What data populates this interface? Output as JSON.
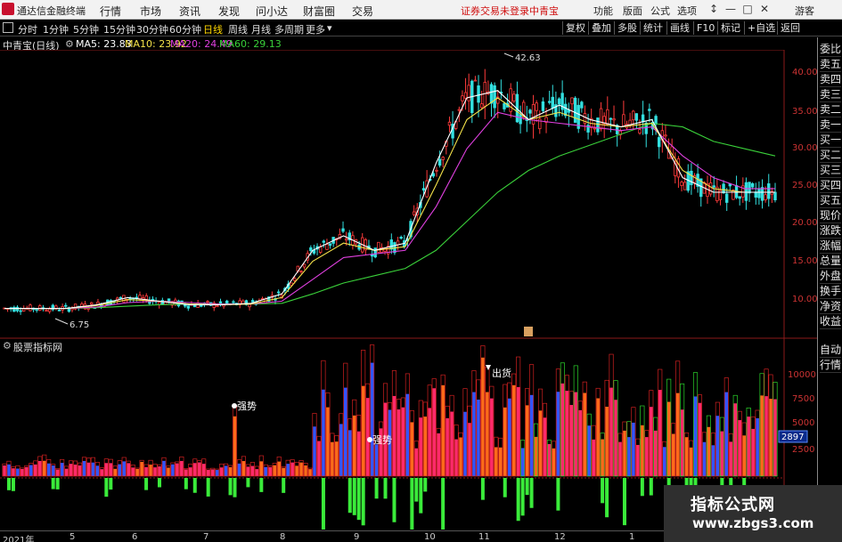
{
  "app": {
    "title": "通达信金融终端"
  },
  "menu": [
    "行情",
    "市场",
    "资讯",
    "发现",
    "问小达",
    "财富圈",
    "交易"
  ],
  "announcement": "证券交易未登录",
  "stock_name": "中青宝",
  "right_menu": [
    "功能",
    "版面",
    "公式",
    "选项"
  ],
  "guest_label": "游客",
  "window_controls": {
    "pin": "↕",
    "min": "—",
    "max": "□",
    "close": "✕"
  },
  "periods": [
    "分时",
    "1分钟",
    "5分钟",
    "15分钟",
    "30分钟",
    "60分钟",
    "日线",
    "周线",
    "月线",
    "多周期",
    "更多"
  ],
  "active_period": "日线",
  "more_arrow": "▾",
  "toolbar_buttons": [
    "复权",
    "叠加",
    "多股",
    "统计",
    "画线",
    "F10",
    "标记",
    "+自选",
    "返回"
  ],
  "price_header": {
    "title": "中青宝(日线)",
    "ma": [
      {
        "label": "MA5: 23.83",
        "color": "#ffffff"
      },
      {
        "label": "MA10: 23.92",
        "color": "#f5e34a"
      },
      {
        "label": "MA20: 24.49",
        "color": "#e040e0"
      },
      {
        "label": "MA60: 29.13",
        "color": "#3ad13a"
      }
    ]
  },
  "indicator_header": {
    "title": "股票指标网"
  },
  "sidebar_top": [
    "委比",
    "卖五",
    "卖四",
    "卖三",
    "卖二",
    "卖一",
    "买一",
    "买二",
    "买三",
    "买四",
    "买五",
    "现价",
    "涨跌",
    "涨幅",
    "总量",
    "外盘",
    "换手",
    "净资",
    "收益"
  ],
  "sidebar_bottom": [
    "自动",
    "行情"
  ],
  "price_axis": [
    "40.00",
    "35.00",
    "30.00",
    "25.00",
    "20.00",
    "15.00",
    "10.00"
  ],
  "volume_axis": [
    "10000",
    "7500",
    "5000",
    "2500"
  ],
  "volume_current": "2897",
  "annotations": {
    "high": "42.63",
    "low": "6.75",
    "strong1": "强势",
    "strong2": "强势",
    "sell": "出货"
  },
  "x_axis": [
    "2021年",
    "5",
    "6",
    "7",
    "8",
    "9",
    "10",
    "11",
    "12",
    "1"
  ],
  "watermark": {
    "line1": "指标公式网",
    "line2": "www.zbgs3.com"
  },
  "chart_data": {
    "type": "candlestick",
    "price_range": [
      5,
      43
    ],
    "ma5": [
      8,
      8,
      8,
      8.5,
      9.5,
      9,
      8.5,
      8.5,
      8.7,
      10,
      16,
      18,
      16,
      17,
      28,
      37,
      38,
      34,
      36,
      34,
      33,
      34,
      26,
      24,
      24,
      24
    ],
    "ma10": [
      8,
      8,
      8,
      8.4,
      9.2,
      9,
      8.6,
      8.5,
      8.6,
      9.5,
      14.5,
      17,
      16,
      16.5,
      25,
      34,
      37,
      34,
      35,
      33.5,
      33,
      33.5,
      27,
      24.5,
      24,
      24
    ],
    "ma20": [
      8,
      8,
      8,
      8.2,
      8.8,
      9,
      8.8,
      8.6,
      8.6,
      9,
      12,
      15,
      15.5,
      16,
      22,
      30,
      35,
      34,
      33.5,
      33,
      32.5,
      33,
      29,
      26,
      24.5,
      24.5
    ],
    "ma60": [
      8,
      8,
      8,
      8.1,
      8.3,
      8.5,
      8.6,
      8.6,
      8.6,
      8.7,
      10,
      11.5,
      12.5,
      13.5,
      16,
      20,
      24,
      27,
      29,
      30.5,
      32,
      33.5,
      33,
      31,
      30,
      29
    ],
    "volume_range": [
      0,
      12000
    ]
  }
}
